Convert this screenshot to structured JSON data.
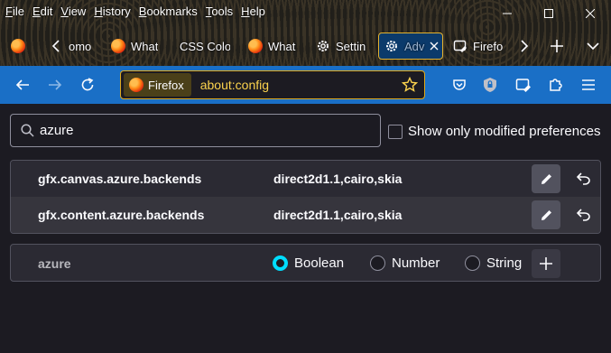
{
  "menubar": {
    "items": [
      "File",
      "Edit",
      "View",
      "History",
      "Bookmarks",
      "Tools",
      "Help"
    ]
  },
  "tabs": [
    {
      "label": "omo",
      "icon": "firefox-icon"
    },
    {
      "label": "What",
      "icon": "firefox-icon"
    },
    {
      "label": "CSS Color",
      "icon": ""
    },
    {
      "label": "What",
      "icon": "firefox-icon"
    },
    {
      "label": "Settin",
      "icon": "gear-icon"
    },
    {
      "label": "Adv",
      "icon": "gear-icon",
      "active": true
    },
    {
      "label": "Firefo",
      "icon": "config-icon"
    }
  ],
  "navbar": {
    "identity_label": "Firefox",
    "url": "about:config"
  },
  "search": {
    "value": "azure"
  },
  "modified_only": {
    "label": "Show only modified preferences",
    "checked": false
  },
  "prefs": [
    {
      "name": "gfx.canvas.azure.backends",
      "value": "direct2d1.1,cairo,skia"
    },
    {
      "name": "gfx.content.azure.backends",
      "value": "direct2d1.1,cairo,skia"
    }
  ],
  "add_pref": {
    "name": "azure",
    "types": [
      {
        "label": "Boolean",
        "selected": true
      },
      {
        "label": "Number",
        "selected": false
      },
      {
        "label": "String",
        "selected": false
      }
    ]
  },
  "colors": {
    "toolbar": "#1a6fc6",
    "url_highlight": "#fcd34d",
    "radio_selected": "#00ddff",
    "active_tab": "#0b3a6b"
  }
}
